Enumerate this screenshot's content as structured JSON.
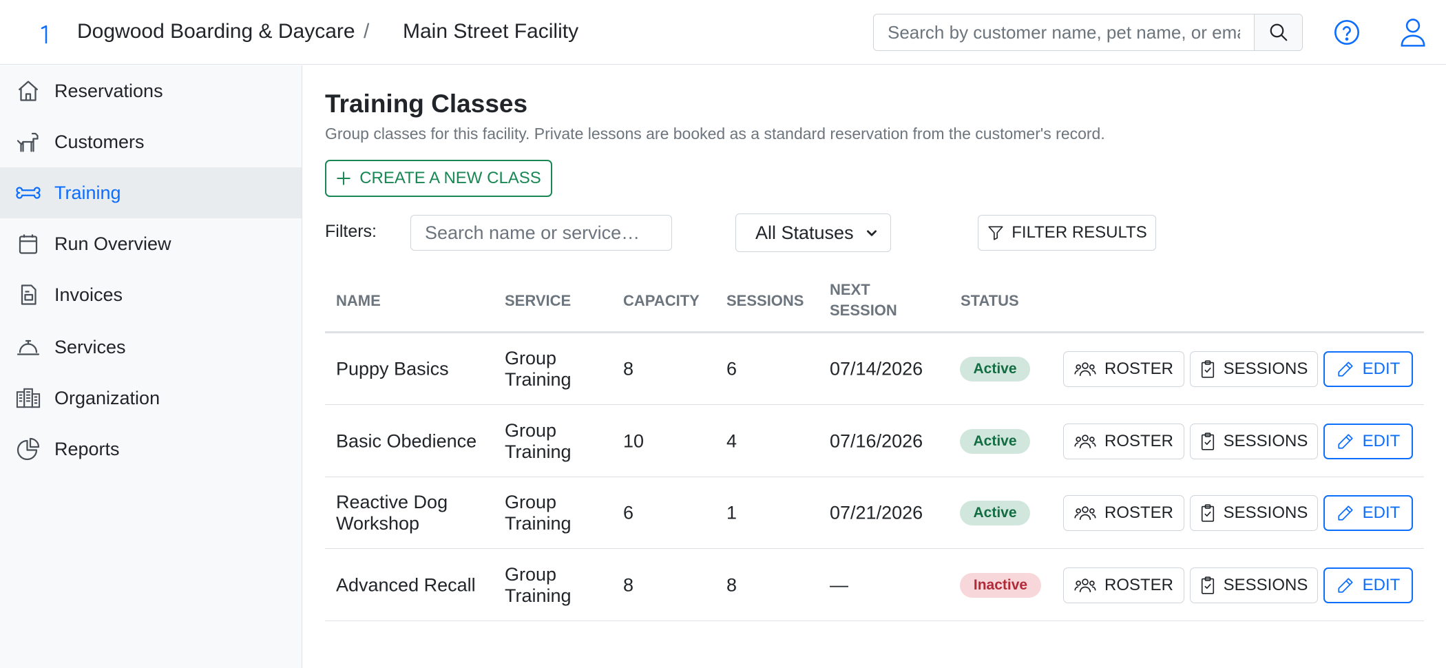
{
  "header": {
    "org_name": "Dogwood Boarding & Daycare",
    "separator": "/",
    "facility_name": "Main Street Facility",
    "search_placeholder": "Search by customer name, pet name, or email"
  },
  "sidebar": {
    "items": [
      {
        "label": "Reservations",
        "icon": "house-icon"
      },
      {
        "label": "Customers",
        "icon": "dog-icon"
      },
      {
        "label": "Training",
        "icon": "bone-icon",
        "active": true
      },
      {
        "label": "Run Overview",
        "icon": "calendar-icon"
      },
      {
        "label": "Invoices",
        "icon": "invoice-icon"
      },
      {
        "label": "Services",
        "icon": "service-bell-icon"
      },
      {
        "label": "Organization",
        "icon": "buildings-icon"
      },
      {
        "label": "Reports",
        "icon": "pie-chart-icon"
      }
    ]
  },
  "main": {
    "title": "Training Classes",
    "description": "Group classes for this facility. Private lessons are booked as a standard reservation from the customer's record.",
    "create_label": "CREATE A NEW CLASS",
    "filters_label": "Filters:",
    "filter_search_placeholder": "Search name or service…",
    "status_selected": "All Statuses",
    "filter_button_label": "FILTER RESULTS"
  },
  "table": {
    "columns": {
      "name": "NAME",
      "service": "SERVICE",
      "capacity": "CAPACITY",
      "sessions": "SESSIONS",
      "next_session_1": "NEXT",
      "next_session_2": "SESSION",
      "status": "STATUS"
    },
    "actions": {
      "roster": "ROSTER",
      "sessions": "SESSIONS",
      "edit": "EDIT"
    },
    "rows": [
      {
        "name_1": "Puppy Basics",
        "name_2": "",
        "service_1": "Group",
        "service_2": "Training",
        "capacity": "8",
        "sessions": "6",
        "next_session": "07/14/2026",
        "status": "Active"
      },
      {
        "name_1": "Basic Obedience",
        "name_2": "",
        "service_1": "Group",
        "service_2": "Training",
        "capacity": "10",
        "sessions": "4",
        "next_session": "07/16/2026",
        "status": "Active"
      },
      {
        "name_1": "Reactive Dog",
        "name_2": "Workshop",
        "service_1": "Group",
        "service_2": "Training",
        "capacity": "6",
        "sessions": "1",
        "next_session": "07/21/2026",
        "status": "Active"
      },
      {
        "name_1": "Advanced Recall",
        "name_2": "",
        "service_1": "Group",
        "service_2": "Training",
        "capacity": "8",
        "sessions": "8",
        "next_session": "—",
        "status": "Inactive"
      }
    ]
  },
  "colors": {
    "accent_blue": "#0d6efd",
    "create_green": "#198754",
    "active_badge_bg": "#d1e7dd",
    "inactive_badge_bg": "#f8d7da"
  }
}
